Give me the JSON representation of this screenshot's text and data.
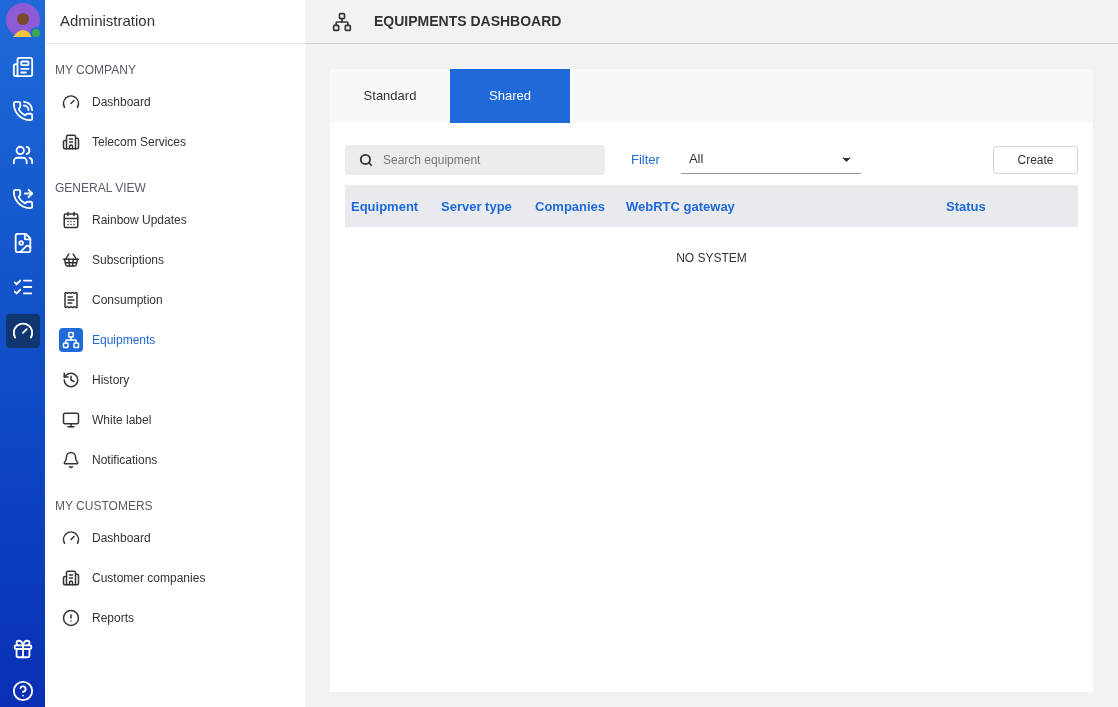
{
  "rail": {
    "avatar": {
      "online": true
    },
    "items": [
      {
        "selected": false
      },
      {
        "selected": false
      },
      {
        "selected": false
      },
      {
        "selected": false
      },
      {
        "selected": false
      },
      {
        "selected": false
      },
      {
        "selected": true
      }
    ]
  },
  "sidebar": {
    "title": "Administration",
    "sections": [
      {
        "title": "MY COMPANY",
        "items": [
          {
            "label": "Dashboard",
            "selected": false
          },
          {
            "label": "Telecom Services",
            "selected": false
          }
        ]
      },
      {
        "title": "GENERAL VIEW",
        "items": [
          {
            "label": "Rainbow Updates",
            "selected": false
          },
          {
            "label": "Subscriptions",
            "selected": false
          },
          {
            "label": "Consumption",
            "selected": false
          },
          {
            "label": "Equipments",
            "selected": true
          },
          {
            "label": "History",
            "selected": false
          },
          {
            "label": "White label",
            "selected": false
          },
          {
            "label": "Notifications",
            "selected": false
          }
        ]
      },
      {
        "title": "MY CUSTOMERS",
        "items": [
          {
            "label": "Dashboard",
            "selected": false
          },
          {
            "label": "Customer companies",
            "selected": false
          },
          {
            "label": "Reports",
            "selected": false
          }
        ]
      }
    ]
  },
  "header": {
    "title": "EQUIPMENTS DASHBOARD"
  },
  "tabs": [
    {
      "label": "Standard",
      "selected": false
    },
    {
      "label": "Shared",
      "selected": true
    }
  ],
  "search": {
    "placeholder": "Search equipment"
  },
  "filter": {
    "label": "Filter",
    "value": "All"
  },
  "create_button": "Create",
  "table": {
    "columns": [
      "Equipment",
      "Server type",
      "Companies",
      "WebRTC gateway",
      "Status"
    ],
    "empty_text": "NO SYSTEM"
  }
}
